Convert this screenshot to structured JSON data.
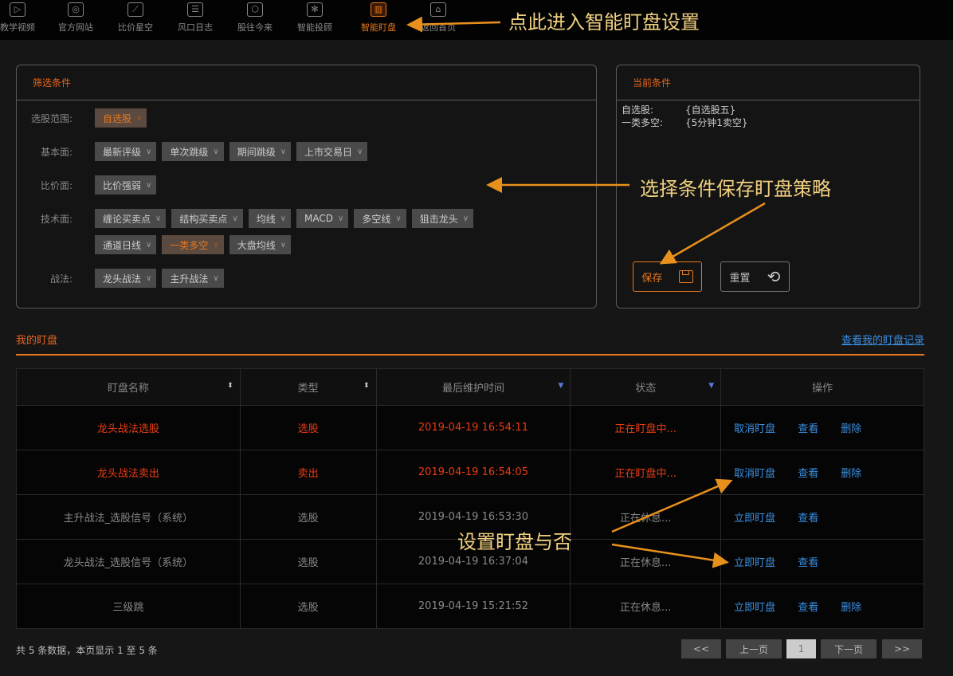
{
  "nav": [
    {
      "label": "教学视频",
      "icon": "play-icon",
      "glyph": "▷"
    },
    {
      "label": "官方网站",
      "icon": "globe-icon",
      "glyph": "◎"
    },
    {
      "label": "比价星空",
      "icon": "chart-icon",
      "glyph": "⟋"
    },
    {
      "label": "风口日志",
      "icon": "notepad-icon",
      "glyph": "☰"
    },
    {
      "label": "股往今来",
      "icon": "cube-icon",
      "glyph": "⬡"
    },
    {
      "label": "智能投顾",
      "icon": "atom-icon",
      "glyph": "✻"
    },
    {
      "label": "智能盯盘",
      "icon": "monitor-chart-icon",
      "glyph": "▥",
      "active": true
    },
    {
      "label": "返回首页",
      "icon": "home-icon",
      "glyph": "⌂"
    }
  ],
  "filter": {
    "title": "筛选条件",
    "rows": [
      {
        "label": "选股范围:",
        "chips": [
          {
            "t": "自选股",
            "sel": true
          }
        ]
      },
      {
        "label": "基本面:",
        "chips": [
          {
            "t": "最新评级"
          },
          {
            "t": "单次跳级"
          },
          {
            "t": "期间跳级"
          },
          {
            "t": "上市交易日"
          }
        ]
      },
      {
        "label": "比价面:",
        "chips": [
          {
            "t": "比价强弱"
          }
        ]
      },
      {
        "label": "技术面:",
        "chips": [
          {
            "t": "缠论买卖点"
          },
          {
            "t": "结构买卖点"
          },
          {
            "t": "均线"
          },
          {
            "t": "MACD"
          },
          {
            "t": "多空线"
          },
          {
            "t": "狙击龙头"
          }
        ]
      },
      {
        "label": "",
        "chips": [
          {
            "t": "通道日线"
          },
          {
            "t": "一类多空",
            "sel": true
          },
          {
            "t": "大盘均线"
          }
        ]
      },
      {
        "label": "战法:",
        "chips": [
          {
            "t": "龙头战法"
          },
          {
            "t": "主升战法"
          }
        ]
      }
    ]
  },
  "current": {
    "title": "当前条件",
    "items": [
      {
        "k": "自选股:",
        "v": "{自选股五}"
      },
      {
        "k": "一类多空:",
        "v": "{5分钟1卖空}"
      }
    ],
    "save_label": "保存",
    "reset_label": "重置"
  },
  "mine": {
    "title": "我的盯盘",
    "record_link": "查看我的盯盘记录"
  },
  "table": {
    "headers": [
      "盯盘名称",
      "类型",
      "最后维护时间",
      "状态",
      "操作"
    ],
    "rows": [
      {
        "name": "龙头战法选股",
        "type": "选股",
        "time": "2019-04-19 16:54:11",
        "status": "正在盯盘中...",
        "ops": [
          "取消盯盘",
          "查看",
          "删除"
        ],
        "hot": true
      },
      {
        "name": "龙头战法卖出",
        "type": "卖出",
        "time": "2019-04-19 16:54:05",
        "status": "正在盯盘中...",
        "ops": [
          "取消盯盘",
          "查看",
          "删除"
        ],
        "hot": true
      },
      {
        "name": "主升战法_选股信号（系统）",
        "type": "选股",
        "time": "2019-04-19 16:53:30",
        "status": "正在休息...",
        "ops": [
          "立即盯盘",
          "查看"
        ]
      },
      {
        "name": "龙头战法_选股信号（系统）",
        "type": "选股",
        "time": "2019-04-19 16:37:04",
        "status": "正在休息...",
        "ops": [
          "立即盯盘",
          "查看"
        ]
      },
      {
        "name": "三级跳",
        "type": "选股",
        "time": "2019-04-19 15:21:52",
        "status": "正在休息...",
        "ops": [
          "立即盯盘",
          "查看",
          "删除"
        ]
      }
    ]
  },
  "footer": {
    "summary": "共 5 条数据，本页显示 1 至 5 条",
    "first": "<<",
    "prev": "上一页",
    "page": "1",
    "next": "下一页",
    "last": ">>"
  },
  "annotations": {
    "a1": "点此进入智能盯盘设置",
    "a2": "选择条件保存盯盘策略",
    "a3": "设置盯盘与否"
  },
  "colors": {
    "accent": "#e8781c",
    "hot": "#e83c14",
    "link": "#3a8ee0",
    "annotation": "#f0d080"
  }
}
